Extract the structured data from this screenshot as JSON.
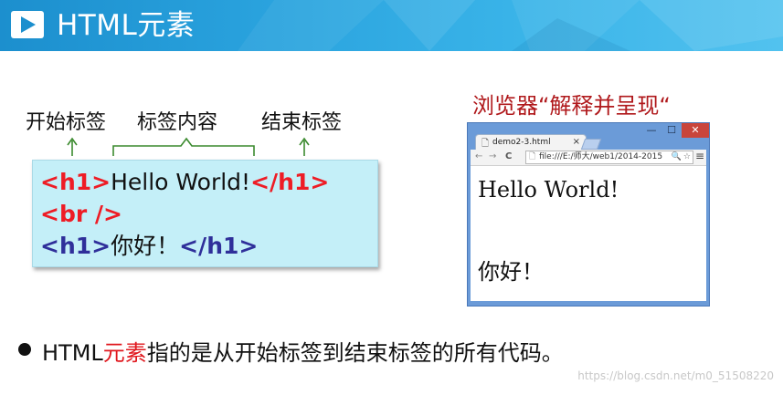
{
  "banner": {
    "title": "HTML元素",
    "logo_icon": "play-triangle-icon",
    "colors": {
      "left": "#1c8fce",
      "right": "#52c2ef"
    }
  },
  "labels": {
    "start_tag": "开始标签",
    "content": "标签内容",
    "end_tag": "结束标签"
  },
  "code": {
    "line1": {
      "open": "<h1>",
      "text": "Hello World!",
      "close": "</h1>"
    },
    "line2": {
      "tag": "<br />"
    },
    "line3": {
      "open": "<h1>",
      "text": "你好！",
      "close": "</h1>"
    },
    "colors": {
      "red_tag": "#ee1c25",
      "blue_tag": "#2f2f9a",
      "background": "#c4eff8"
    }
  },
  "side": {
    "title": "浏览器“解释并呈现“"
  },
  "browser": {
    "tab_title": "demo2-3.html",
    "tab_close": "×",
    "win_min": "—",
    "win_max": "☐",
    "win_close": "✕",
    "back_icon": "←",
    "forward_icon": "→",
    "reload_icon": "C",
    "address": "file:///E:/师大/web1/2014-2015",
    "zoom_icon": "🔍",
    "star_icon": "☆",
    "menu_icon": "≡",
    "page": {
      "h1_first": "Hello World!",
      "h1_second": "你好！"
    }
  },
  "bullet": {
    "prefix": "HTML",
    "accent": "元素",
    "suffix": "指的是从开始标签到结束标签的所有代码。"
  },
  "watermark": "https://blog.csdn.net/m0_51508220"
}
